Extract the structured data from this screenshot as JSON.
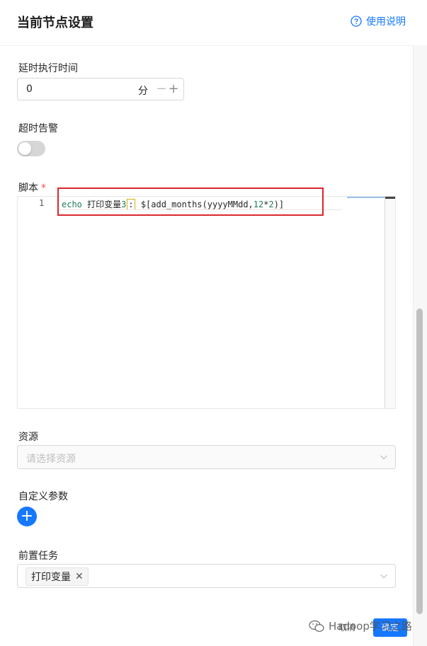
{
  "header": {
    "title": "当前节点设置",
    "help_label": "使用说明"
  },
  "delay": {
    "label": "延时执行时间",
    "value": "0",
    "unit": "分",
    "minus": "−",
    "plus": "+"
  },
  "timeout": {
    "label": "超时告警",
    "enabled": false
  },
  "script": {
    "label": "脚本",
    "required_mark": "*",
    "line_number": "1",
    "code": {
      "keyword": "echo",
      "text1": " 打印变量",
      "num": "3",
      "cursor_char": ":",
      "text2": " $[add_months(yyyyMMdd,",
      "num2": "12",
      "op": "*",
      "num3": "2",
      "tail": ")]"
    }
  },
  "resource": {
    "label": "资源",
    "placeholder": "请选择资源"
  },
  "custom_params": {
    "label": "自定义参数",
    "add_symbol": "+"
  },
  "pre_tasks": {
    "label": "前置任务",
    "tags": [
      "打印变量"
    ],
    "tag_close": "✕"
  },
  "footer": {
    "cancel": "取消",
    "ok": "确定",
    "watermark": "Hadoop学习之路"
  },
  "colors": {
    "accent": "#1677ff",
    "required": "#ff4d4f",
    "highlight": "#d9282d"
  }
}
